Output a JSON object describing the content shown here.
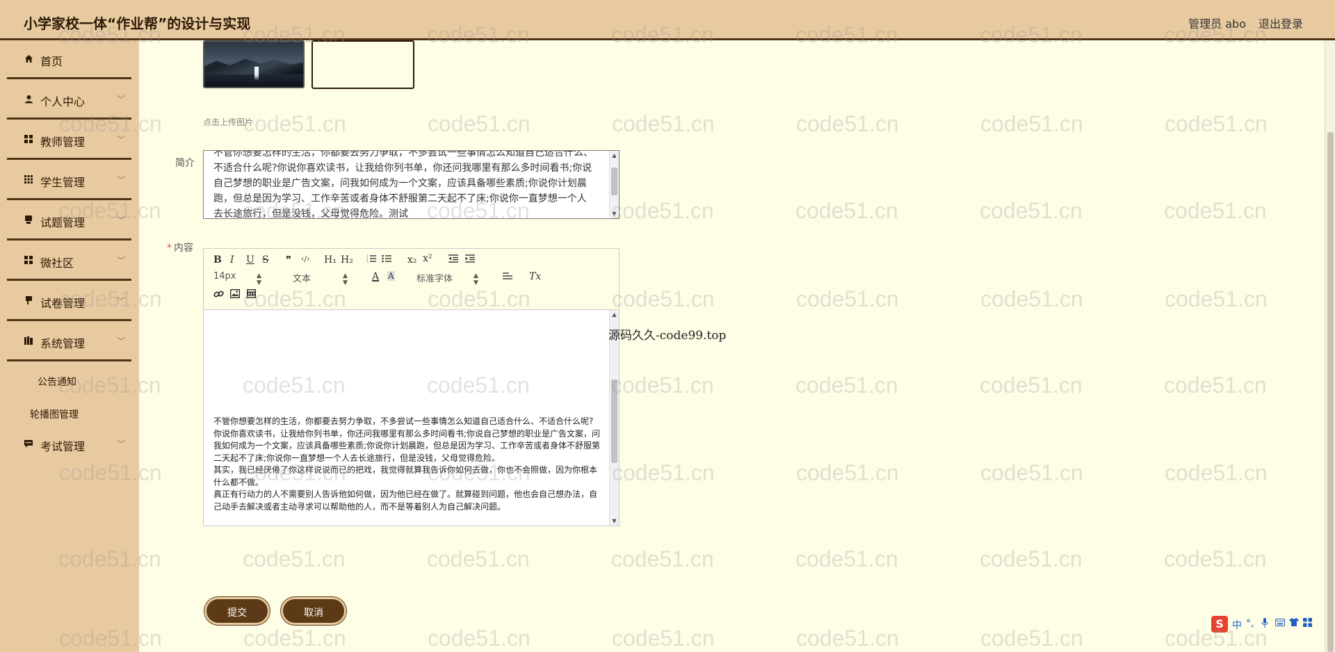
{
  "header": {
    "title": "小学家校一体“作业帮”的设计与实现",
    "user": "管理员 abo",
    "logout": "退出登录"
  },
  "sidebar": {
    "items": [
      {
        "label": "首页",
        "icon": "home-icon"
      },
      {
        "label": "个人中心",
        "icon": "user-icon"
      },
      {
        "label": "教师管理",
        "icon": "grid-icon"
      },
      {
        "label": "学生管理",
        "icon": "apps-icon"
      },
      {
        "label": "试题管理",
        "icon": "pad-icon"
      },
      {
        "label": "微社区",
        "icon": "grid-icon"
      },
      {
        "label": "试卷管理",
        "icon": "flag-icon"
      },
      {
        "label": "系统管理",
        "icon": "books-icon"
      },
      {
        "label": "考试管理",
        "icon": "chat-icon"
      }
    ],
    "system_sub": [
      "公告通知",
      "轮播图管理"
    ]
  },
  "form": {
    "upload_hint": "点击上传图片",
    "intro_label": "简介",
    "intro_lines": [
      "不管你想要怎样的生活，你都要去努力争取，不多尝试一些事情怎么知道自己适合什么、",
      "不适合什么呢?你说你喜欢读书，让我给你列书单，你还问我哪里有那么多时间看书;你说",
      "自己梦想的职业是广告文案，问我如何成为一个文案，应该具备哪些素质;你说你计划晨",
      "跑，但总是因为学习、工作辛苦或者身体不舒服第二天起不了床;你说你一直梦想一个人",
      "去长途旅行，但是没钱，父母觉得危险。测试"
    ],
    "content_label": "内容",
    "toolbar": {
      "bold": "B",
      "italic": "I",
      "underline": "U",
      "strike": "S",
      "quote": "❞",
      "code": "‹/›",
      "h1": "H₁",
      "h2": "H₂",
      "sub": "x₂",
      "sup": "x²",
      "size": "14px",
      "text_type": "文本",
      "font": "标准字体",
      "color_a": "A",
      "bg_a": "A",
      "clear": "Tx"
    },
    "content_paragraphs": [
      "不管你想要怎样的生活，你都要去努力争取，不多尝试一些事情怎么知道自己适合什么、不适合什么呢?",
      "你说你喜欢读书，让我给你列书单，你还问我哪里有那么多时间看书;你说自己梦想的职业是广告文案，问我如何成为一个文案，应该具备哪些素质;你说你计划晨跑，但总是因为学习、工作辛苦或者身体不舒服第二天起不了床;你说你一直梦想一个人去长途旅行，但是没钱，父母觉得危险。",
      "其实，我已经厌倦了你这样说说而已的把戏，我觉得就算我告诉你如何去做，你也不会照做，因为你根本什么都不做。",
      "真正有行动力的人不需要别人告诉他如何做，因为他已经在做了。就算碰到问题，他也会自己想办法，自己动手去解决或者主动寻求可以帮助他的人，而不是等着别人为自己解决问题。"
    ],
    "submit": "提交",
    "cancel": "取消"
  },
  "overlay_text": "源码久久-code99.top",
  "watermark": "code51.cn",
  "ime": {
    "logo": "S",
    "lang": "中"
  },
  "colors": {
    "sidebar_bg": "#e8caa0",
    "main_bg": "#fefde6",
    "accent": "#5c3a17"
  }
}
